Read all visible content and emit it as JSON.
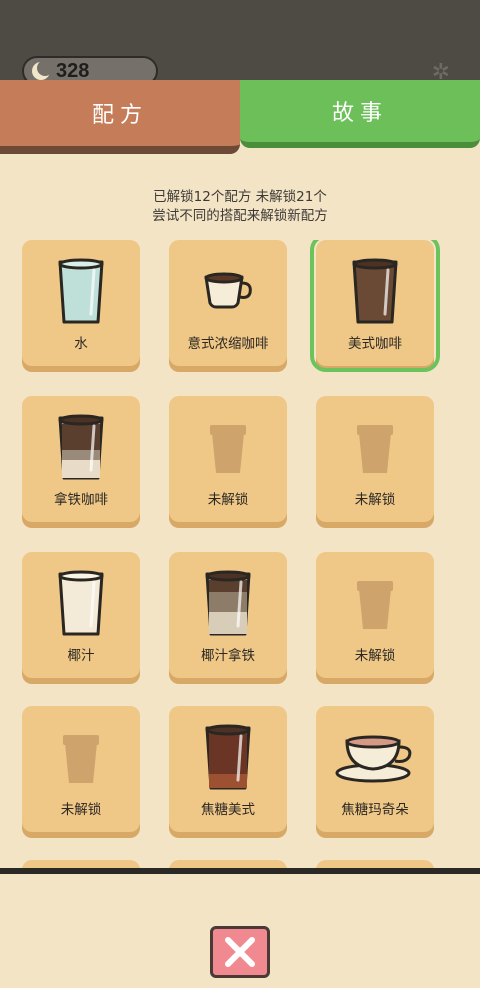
{
  "status": {
    "coins": "328"
  },
  "tabs": {
    "recipe": "配方",
    "story": "故事"
  },
  "summary": {
    "line1": "已解锁12个配方 未解锁21个",
    "line2": "尝试不同的搭配来解锁新配方"
  },
  "recipes": [
    {
      "label": "水",
      "icon": "water-glass-icon",
      "selected": false
    },
    {
      "label": "意式浓缩咖啡",
      "icon": "espresso-cup-icon",
      "selected": false
    },
    {
      "label": "美式咖啡",
      "icon": "americano-glass-icon",
      "selected": true
    },
    {
      "label": "拿铁咖啡",
      "icon": "latte-glass-icon",
      "selected": false
    },
    {
      "label": "未解锁",
      "icon": "locked-cup-icon",
      "selected": false
    },
    {
      "label": "未解锁",
      "icon": "locked-cup-icon",
      "selected": false
    },
    {
      "label": "椰汁",
      "icon": "coconut-milk-glass-icon",
      "selected": false
    },
    {
      "label": "椰汁拿铁",
      "icon": "coconut-latte-glass-icon",
      "selected": false
    },
    {
      "label": "未解锁",
      "icon": "locked-cup-icon",
      "selected": false
    },
    {
      "label": "未解锁",
      "icon": "locked-cup-icon",
      "selected": false
    },
    {
      "label": "焦糖美式",
      "icon": "caramel-americano-glass-icon",
      "selected": false
    },
    {
      "label": "焦糖玛奇朵",
      "icon": "caramel-macchiato-cup-icon",
      "selected": false
    }
  ],
  "colors": {
    "tab_recipe": "#c57d59",
    "tab_story": "#6cbf59",
    "card": "#efc786",
    "background": "#f3e4c6",
    "selected_outline": "#6cc35c",
    "close_button": "#f08a90"
  }
}
